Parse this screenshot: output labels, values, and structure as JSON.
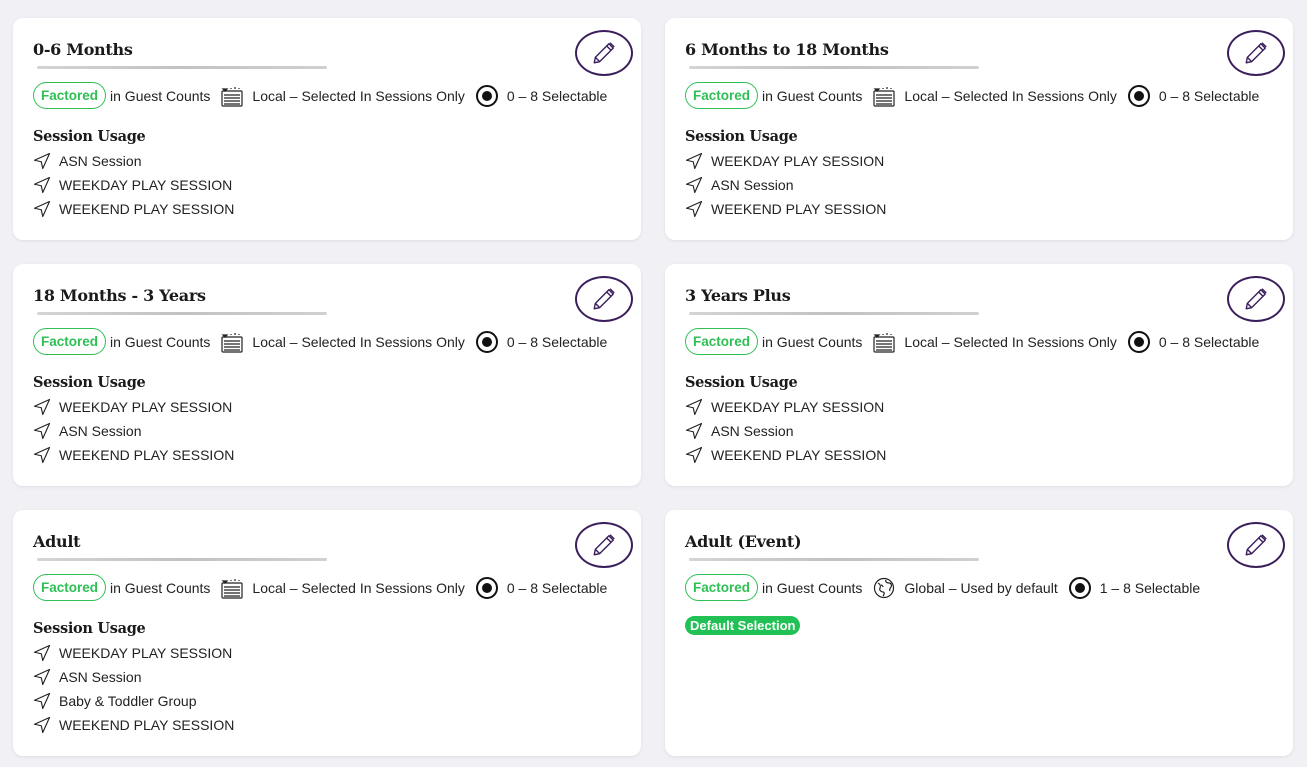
{
  "labels": {
    "factored": "Factored",
    "in_guest_counts": "in Guest Counts",
    "session_usage": "Session Usage",
    "edit": "Edit"
  },
  "colors": {
    "accent_green": "#2fbf55",
    "edit_border": "#3a1f5c",
    "background": "#f1f0f5"
  },
  "cards": [
    {
      "title": "0-6 Months",
      "scope_icon": "local-list-icon",
      "scope": "Local – Selected In Sessions Only",
      "selectable": "0 – 8 Selectable",
      "sessions": [
        "ASN Session",
        "WEEKDAY PLAY SESSION",
        "WEEKEND PLAY SESSION"
      ]
    },
    {
      "title": "6 Months to 18 Months",
      "scope_icon": "local-list-icon",
      "scope": "Local – Selected In Sessions Only",
      "selectable": "0 – 8 Selectable",
      "sessions": [
        "WEEKDAY PLAY SESSION",
        "ASN Session",
        "WEEKEND PLAY SESSION"
      ]
    },
    {
      "title": "18 Months - 3 Years",
      "scope_icon": "local-list-icon",
      "scope": "Local – Selected In Sessions Only",
      "selectable": "0 – 8 Selectable",
      "sessions": [
        "WEEKDAY PLAY SESSION",
        "ASN Session",
        "WEEKEND PLAY SESSION"
      ]
    },
    {
      "title": "3 Years Plus",
      "scope_icon": "local-list-icon",
      "scope": "Local – Selected In Sessions Only",
      "selectable": "0 – 8 Selectable",
      "sessions": [
        "WEEKDAY PLAY SESSION",
        "ASN Session",
        "WEEKEND PLAY SESSION"
      ]
    },
    {
      "title": "Adult",
      "scope_icon": "local-list-icon",
      "scope": "Local – Selected In Sessions Only",
      "selectable": "0 – 8 Selectable",
      "sessions": [
        "WEEKDAY PLAY SESSION",
        "ASN Session",
        "Baby & Toddler Group",
        "WEEKEND PLAY SESSION"
      ]
    },
    {
      "title": "Adult (Event)",
      "scope_icon": "globe-icon",
      "scope": "Global – Used by default",
      "selectable": "1 – 8 Selectable",
      "default_badge": "Default Selection",
      "sessions": []
    }
  ]
}
